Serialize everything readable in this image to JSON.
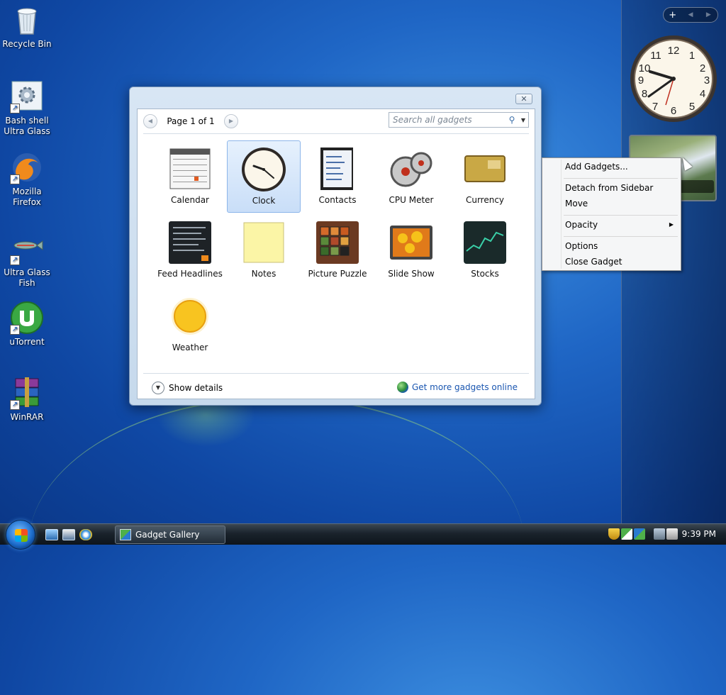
{
  "desktop": {
    "icons": [
      {
        "label": "Recycle Bin"
      },
      {
        "label": "Bash shell Ultra Glass"
      },
      {
        "label": "Mozilla Firefox"
      },
      {
        "label": "Ultra Glass Fish"
      },
      {
        "label": "uTorrent"
      },
      {
        "label": "WinRAR"
      }
    ]
  },
  "sidebar": {
    "add_symbol": "+",
    "prev_symbol": "◀",
    "next_symbol": "▶"
  },
  "gallery": {
    "close_symbol": "✕",
    "page_label": "Page 1 of 1",
    "search_placeholder": "Search all gadgets",
    "gadgets": [
      {
        "label": "Calendar",
        "icon": "calendar-icon"
      },
      {
        "label": "Clock",
        "icon": "clock-icon",
        "selected": true
      },
      {
        "label": "Contacts",
        "icon": "contacts-icon"
      },
      {
        "label": "CPU Meter",
        "icon": "cpu-meter-icon"
      },
      {
        "label": "Currency",
        "icon": "currency-icon"
      },
      {
        "label": "Feed Headlines",
        "icon": "feed-headlines-icon"
      },
      {
        "label": "Notes",
        "icon": "notes-icon"
      },
      {
        "label": "Picture Puzzle",
        "icon": "picture-puzzle-icon"
      },
      {
        "label": "Slide Show",
        "icon": "slide-show-icon"
      },
      {
        "label": "Stocks",
        "icon": "stocks-icon"
      },
      {
        "label": "Weather",
        "icon": "weather-icon"
      }
    ],
    "show_details": "Show details",
    "get_more": "Get more gadgets online"
  },
  "context_menu": {
    "items": [
      "Add Gadgets...",
      "Detach from Sidebar",
      "Move",
      "Opacity",
      "Options",
      "Close Gadget"
    ]
  },
  "taskbar": {
    "task_label": "Gadget Gallery",
    "time": "9:39 PM"
  }
}
